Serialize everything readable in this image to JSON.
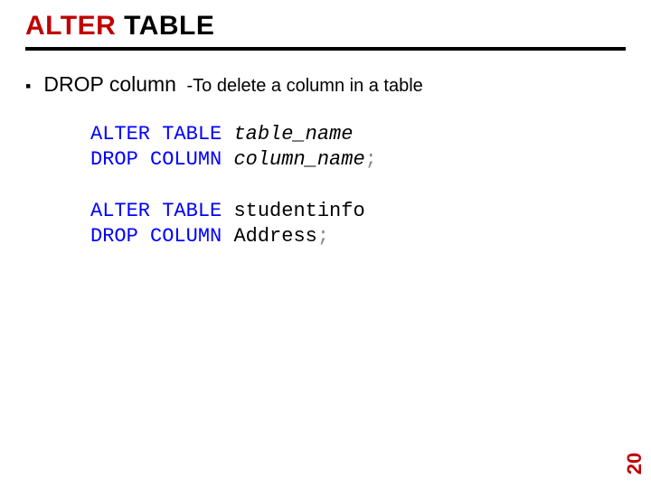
{
  "title": {
    "word1": "ALTER",
    "word2": " TABLE"
  },
  "bullet": {
    "marker": "▪",
    "strong": "DROP column",
    "desc": " -To delete a column in a table"
  },
  "code1": {
    "line1": {
      "kw": "ALTER TABLE ",
      "arg": "table_name"
    },
    "line2": {
      "kw": "DROP COLUMN ",
      "arg": "column_name",
      "semi": ";"
    }
  },
  "code2": {
    "line1": {
      "kw": "ALTER TABLE ",
      "arg": "studentinfo"
    },
    "line2": {
      "kw": "DROP COLUMN ",
      "arg": "Address",
      "semi": ";"
    }
  },
  "page_number": "20"
}
